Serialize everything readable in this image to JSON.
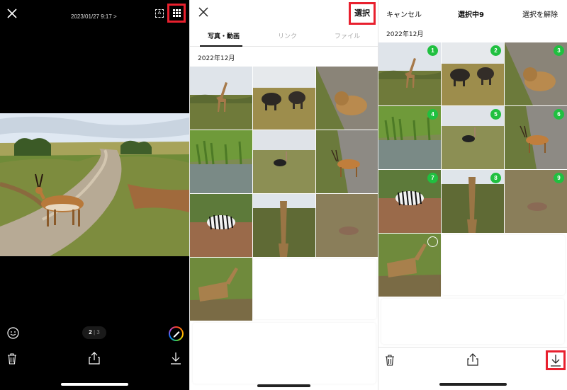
{
  "viewer": {
    "date": "2023/01/27 9:17 >",
    "textbox_glyph": "A",
    "page_current": "2",
    "page_total": "3"
  },
  "gallery": {
    "select_label": "選択",
    "tabs": [
      "写真・動画",
      "リンク",
      "ファイル"
    ],
    "month": "2022年12月"
  },
  "select": {
    "cancel_label": "キャンセル",
    "count_label": "選択中9",
    "deselect_label": "選択を解除",
    "month": "2022年12月",
    "badges": [
      "1",
      "2",
      "3",
      "4",
      "5",
      "6",
      "7",
      "8",
      "9"
    ]
  },
  "colors": {
    "highlight": "#e8202e",
    "badge_green": "#20c040"
  }
}
